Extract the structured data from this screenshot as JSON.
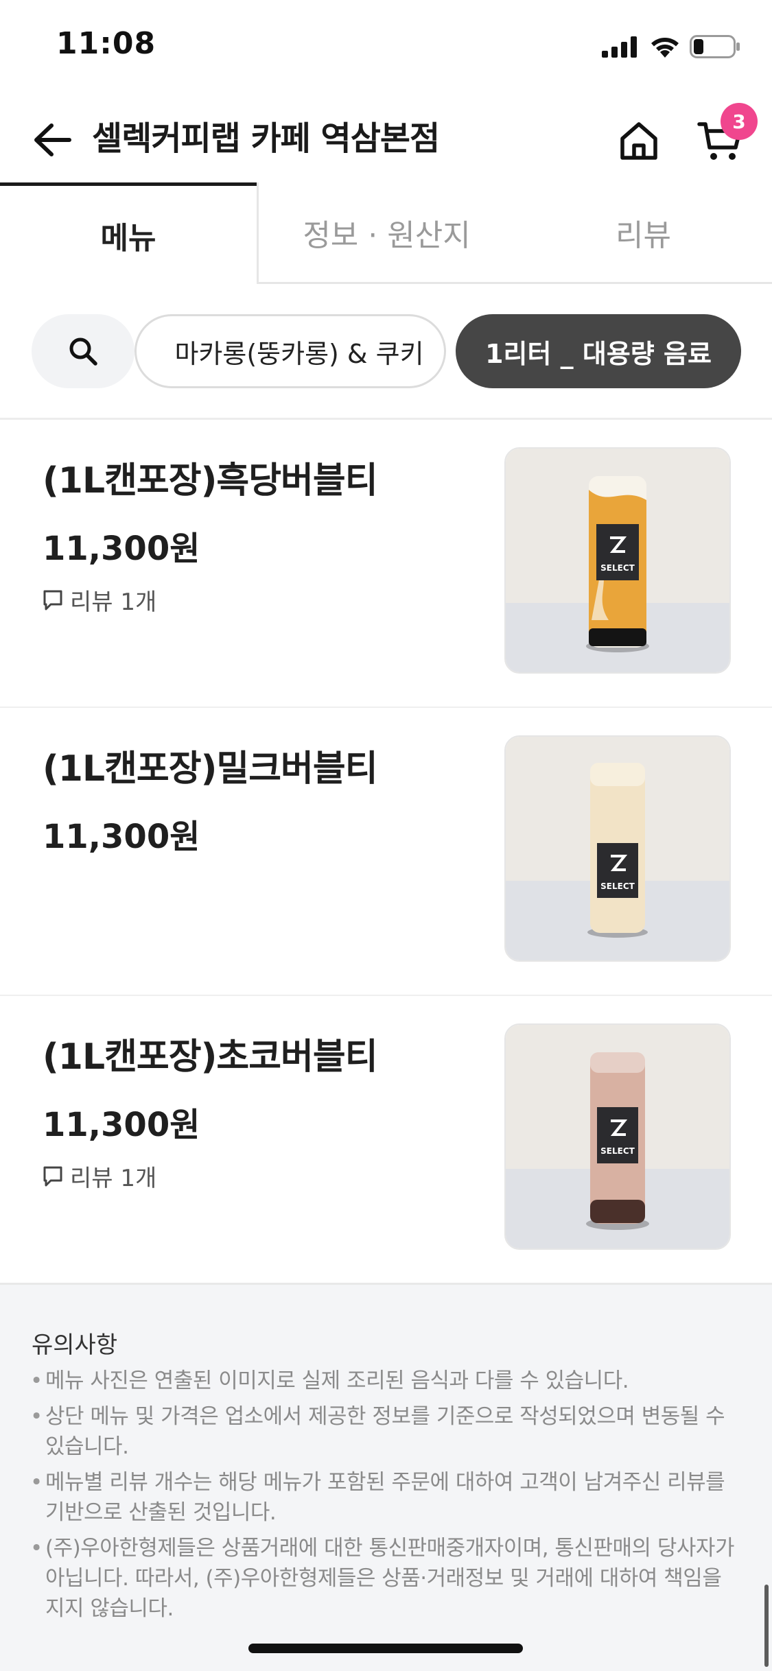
{
  "status_bar": {
    "time": "11:08"
  },
  "header": {
    "store_title": "셀렉커피랩 카페 역삼본점",
    "cart_count": "3"
  },
  "tabs": [
    {
      "label": "메뉴"
    },
    {
      "label": "정보 · 원산지"
    },
    {
      "label": "리뷰"
    }
  ],
  "categories": [
    {
      "label": "마카롱(뚱카롱) & 쿠키"
    },
    {
      "label": "1리터 _ 대용량 음료"
    }
  ],
  "menu_items": [
    {
      "name": "(1L캔포장)흑당버블티",
      "price": "11,300원",
      "review": "리뷰 1개",
      "can_color": "#e9a53a",
      "photo": "bubble-tea-can-brown-sugar"
    },
    {
      "name": "(1L캔포장)밀크버블티",
      "price": "11,300원",
      "review": "",
      "can_color": "#f2e3c6",
      "photo": "bubble-tea-can-milk"
    },
    {
      "name": "(1L캔포장)초코버블티",
      "price": "11,300원",
      "review": "리뷰 1개",
      "can_color": "#d8b1a2",
      "photo": "bubble-tea-can-chocolate"
    }
  ],
  "notice": {
    "title": "유의사항",
    "items": [
      "메뉴 사진은 연출된 이미지로 실제 조리된 음식과 다를 수 있습니다.",
      "상단 메뉴 및 가격은 업소에서 제공한 정보를 기준으로 작성되었으며 변동될 수 있습니다.",
      "메뉴별 리뷰 개수는 해당 메뉴가 포함된 주문에 대하여 고객이 남겨주신 리뷰를 기반으로 산출된 것입니다.",
      "(주)우아한형제들은 상품거래에 대한 통신판매중개자이며, 통신판매의 당사자가 아닙니다. 따라서, (주)우아한형제들은 상품·거래정보 및 거래에 대하여 책임을 지지 않습니다."
    ]
  },
  "colors": {
    "badge": "#f0468e",
    "active_chip": "#464646"
  },
  "icons": [
    "back-arrow-icon",
    "home-icon",
    "cart-icon",
    "search-icon",
    "comment-icon"
  ]
}
